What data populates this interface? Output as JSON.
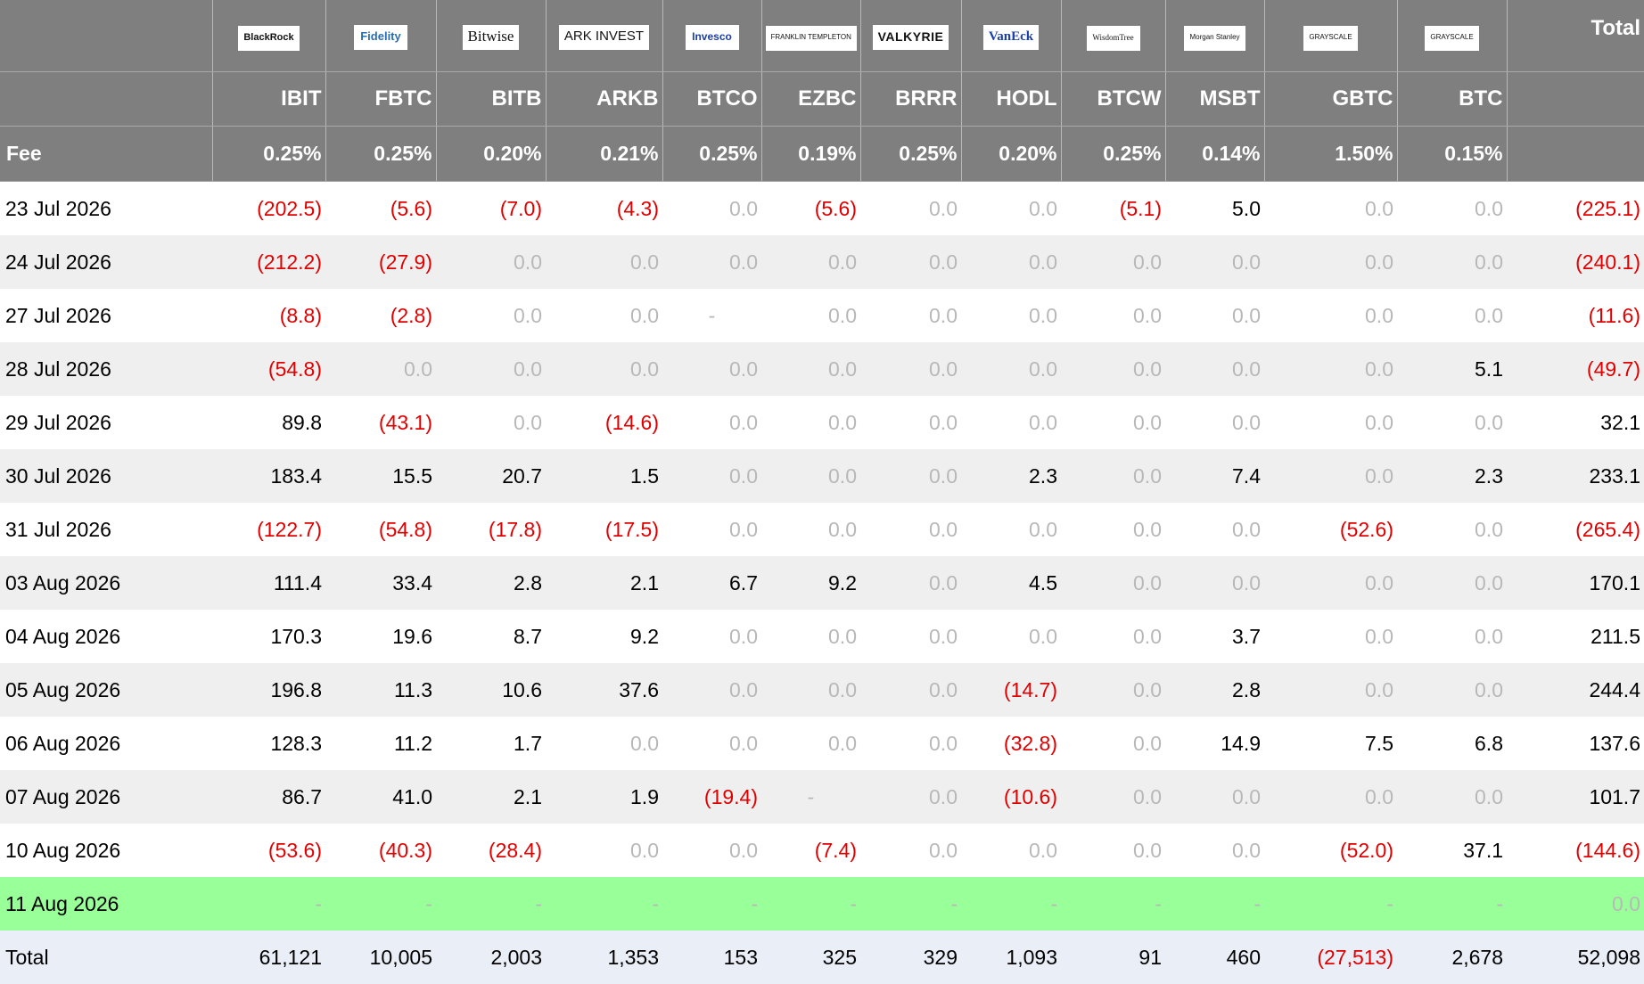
{
  "issuers": [
    {
      "logo": "BlackRock",
      "logo_style": "plain"
    },
    {
      "logo": "Fidelity",
      "logo_style": "fid"
    },
    {
      "logo": "Bitwise",
      "logo_style": "serif"
    },
    {
      "logo": "ARK INVEST",
      "logo_style": "ark"
    },
    {
      "logo": "Invesco",
      "logo_style": "inv"
    },
    {
      "logo": "FRANKLIN TEMPLETON",
      "logo_style": "small"
    },
    {
      "logo": "VALKYRIE",
      "logo_style": "val"
    },
    {
      "logo": "VanEck",
      "logo_style": "van"
    },
    {
      "logo": "WisdomTree",
      "logo_style": "wt"
    },
    {
      "logo": "Morgan Stanley",
      "logo_style": "small"
    },
    {
      "logo": "GRAYSCALE",
      "logo_style": "small"
    },
    {
      "logo": "GRAYSCALE",
      "logo_style": "small"
    }
  ],
  "total_header": "Total",
  "tickers": [
    "IBIT",
    "FBTC",
    "BITB",
    "ARKB",
    "BTCO",
    "EZBC",
    "BRRR",
    "HODL",
    "BTCW",
    "MSBT",
    "GBTC",
    "BTC"
  ],
  "fee_label": "Fee",
  "fees": [
    "0.25%",
    "0.25%",
    "0.20%",
    "0.21%",
    "0.25%",
    "0.19%",
    "0.25%",
    "0.20%",
    "0.25%",
    "0.14%",
    "1.50%",
    "0.15%"
  ],
  "rows": [
    {
      "date": "23 Jul 2026",
      "values": [
        "(202.5)",
        "(5.6)",
        "(7.0)",
        "(4.3)",
        "0.0",
        "(5.6)",
        "0.0",
        "0.0",
        "(5.1)",
        "5.0",
        "0.0",
        "0.0"
      ],
      "total": "(225.1)"
    },
    {
      "date": "24 Jul 2026",
      "values": [
        "(212.2)",
        "(27.9)",
        "0.0",
        "0.0",
        "0.0",
        "0.0",
        "0.0",
        "0.0",
        "0.0",
        "0.0",
        "0.0",
        "0.0"
      ],
      "total": "(240.1)"
    },
    {
      "date": "27 Jul 2026",
      "values": [
        "(8.8)",
        "(2.8)",
        "0.0",
        "0.0",
        "-",
        "0.0",
        "0.0",
        "0.0",
        "0.0",
        "0.0",
        "0.0",
        "0.0"
      ],
      "total": "(11.6)"
    },
    {
      "date": "28 Jul 2026",
      "values": [
        "(54.8)",
        "0.0",
        "0.0",
        "0.0",
        "0.0",
        "0.0",
        "0.0",
        "0.0",
        "0.0",
        "0.0",
        "0.0",
        "5.1"
      ],
      "total": "(49.7)"
    },
    {
      "date": "29 Jul 2026",
      "values": [
        "89.8",
        "(43.1)",
        "0.0",
        "(14.6)",
        "0.0",
        "0.0",
        "0.0",
        "0.0",
        "0.0",
        "0.0",
        "0.0",
        "0.0"
      ],
      "total": "32.1"
    },
    {
      "date": "30 Jul 2026",
      "values": [
        "183.4",
        "15.5",
        "20.7",
        "1.5",
        "0.0",
        "0.0",
        "0.0",
        "2.3",
        "0.0",
        "7.4",
        "0.0",
        "2.3"
      ],
      "total": "233.1"
    },
    {
      "date": "31 Jul 2026",
      "values": [
        "(122.7)",
        "(54.8)",
        "(17.8)",
        "(17.5)",
        "0.0",
        "0.0",
        "0.0",
        "0.0",
        "0.0",
        "0.0",
        "(52.6)",
        "0.0"
      ],
      "total": "(265.4)"
    },
    {
      "date": "03 Aug 2026",
      "values": [
        "111.4",
        "33.4",
        "2.8",
        "2.1",
        "6.7",
        "9.2",
        "0.0",
        "4.5",
        "0.0",
        "0.0",
        "0.0",
        "0.0"
      ],
      "total": "170.1"
    },
    {
      "date": "04 Aug 2026",
      "values": [
        "170.3",
        "19.6",
        "8.7",
        "9.2",
        "0.0",
        "0.0",
        "0.0",
        "0.0",
        "0.0",
        "3.7",
        "0.0",
        "0.0"
      ],
      "total": "211.5"
    },
    {
      "date": "05 Aug 2026",
      "values": [
        "196.8",
        "11.3",
        "10.6",
        "37.6",
        "0.0",
        "0.0",
        "0.0",
        "(14.7)",
        "0.0",
        "2.8",
        "0.0",
        "0.0"
      ],
      "total": "244.4"
    },
    {
      "date": "06 Aug 2026",
      "values": [
        "128.3",
        "11.2",
        "1.7",
        "0.0",
        "0.0",
        "0.0",
        "0.0",
        "(32.8)",
        "0.0",
        "14.9",
        "7.5",
        "6.8"
      ],
      "total": "137.6"
    },
    {
      "date": "07 Aug 2026",
      "values": [
        "86.7",
        "41.0",
        "2.1",
        "1.9",
        "(19.4)",
        "-",
        "0.0",
        "(10.6)",
        "0.0",
        "0.0",
        "0.0",
        "0.0"
      ],
      "total": "101.7"
    },
    {
      "date": "10 Aug 2026",
      "values": [
        "(53.6)",
        "(40.3)",
        "(28.4)",
        "0.0",
        "0.0",
        "(7.4)",
        "0.0",
        "0.0",
        "0.0",
        "0.0",
        "(52.0)",
        "37.1"
      ],
      "total": "(144.6)"
    },
    {
      "date": "11 Aug 2026",
      "values": [
        "-",
        "-",
        "-",
        "-",
        "-",
        "-",
        "-",
        "-",
        "-",
        "-",
        "-",
        "-"
      ],
      "total": "0.0",
      "highlight": true
    }
  ],
  "totals_row": {
    "label": "Total",
    "values": [
      "61,121",
      "10,005",
      "2,003",
      "1,353",
      "153",
      "325",
      "329",
      "1,093",
      "91",
      "460",
      "(27,513)",
      "2,678"
    ],
    "total": "52,098"
  },
  "colors": {
    "header_bg": "#7f7f7f",
    "header_text": "#ffffff",
    "negative": "#e00000",
    "zero": "#b8b8b8",
    "highlight_row": "#99ff99",
    "totals_bg": "#e9eef7",
    "alt_row": "#efefef"
  }
}
